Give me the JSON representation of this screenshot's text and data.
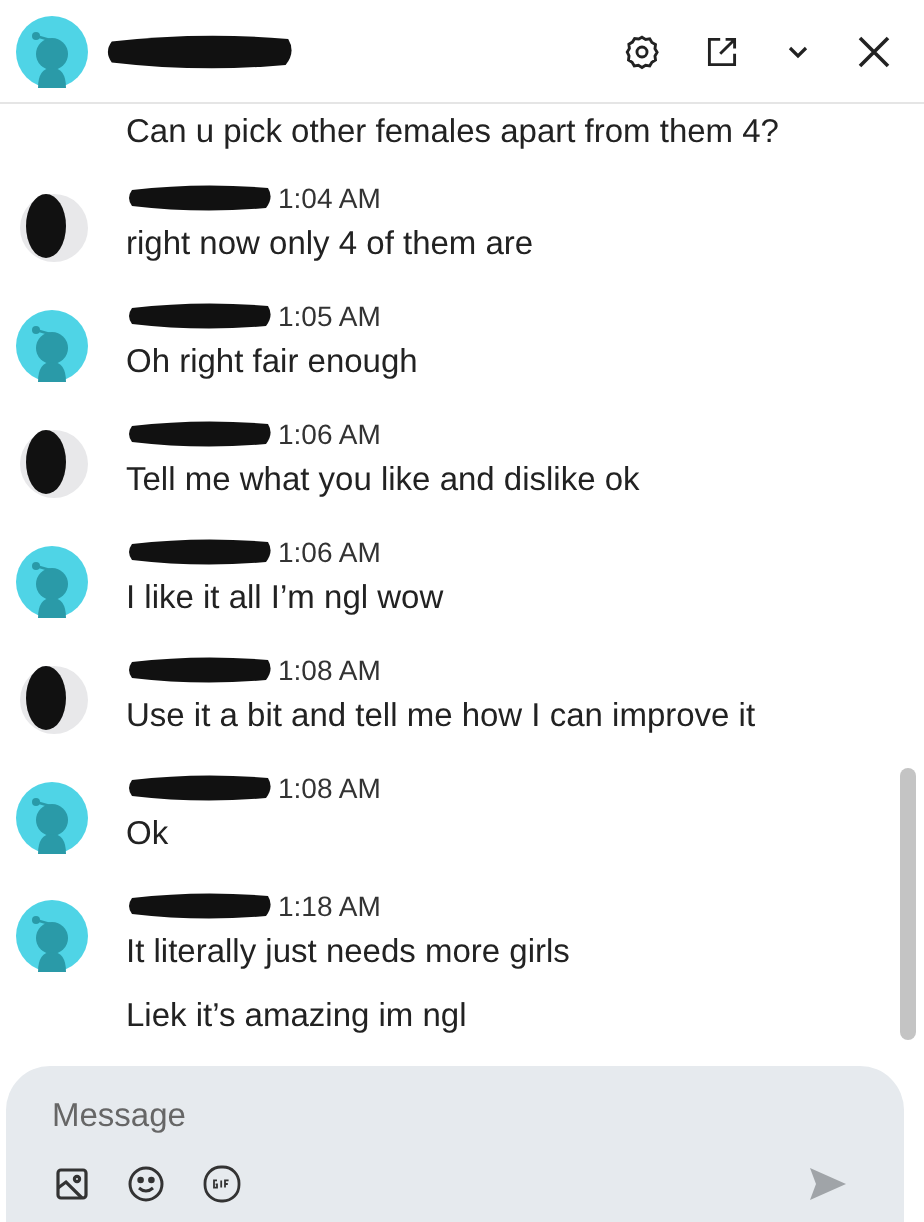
{
  "header": {
    "avatar": {
      "kind": "snoo"
    },
    "actions": [
      {
        "kind": "settings"
      },
      {
        "kind": "popout"
      },
      {
        "kind": "collapse"
      },
      {
        "kind": "close"
      }
    ]
  },
  "messages": [
    {
      "kind": "continuation",
      "lines": [
        "Can u pick other females apart from them 4?"
      ]
    },
    {
      "kind": "group",
      "avatar": {
        "kind": "dark"
      },
      "time": "1:04 AM",
      "lines": [
        "right now only 4 of them are"
      ]
    },
    {
      "kind": "group",
      "avatar": {
        "kind": "snoo"
      },
      "time": "1:05 AM",
      "lines": [
        "Oh right fair enough"
      ]
    },
    {
      "kind": "group",
      "avatar": {
        "kind": "dark"
      },
      "time": "1:06 AM",
      "lines": [
        "Tell me what you like and dislike ok"
      ]
    },
    {
      "kind": "group",
      "avatar": {
        "kind": "snoo"
      },
      "time": "1:06 AM",
      "lines": [
        "I like it all I’m ngl wow"
      ]
    },
    {
      "kind": "group",
      "avatar": {
        "kind": "dark"
      },
      "time": "1:08 AM",
      "lines": [
        "Use it a bit and tell me how I can improve it"
      ]
    },
    {
      "kind": "group",
      "avatar": {
        "kind": "snoo"
      },
      "time": "1:08 AM",
      "lines": [
        "Ok"
      ]
    },
    {
      "kind": "group",
      "avatar": {
        "kind": "snoo"
      },
      "time": "1:18 AM",
      "lines": [
        "It literally just needs more girls",
        "Liek it’s amazing im ngl"
      ]
    }
  ],
  "composer": {
    "placeholder": "Message",
    "tools": [
      {
        "kind": "image"
      },
      {
        "kind": "emoji"
      },
      {
        "kind": "gif"
      }
    ]
  }
}
